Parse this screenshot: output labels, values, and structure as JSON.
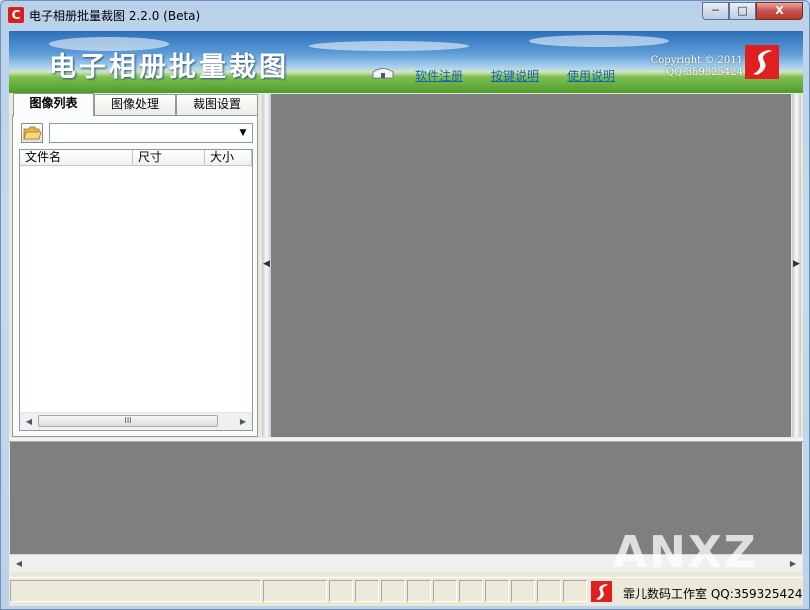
{
  "window": {
    "title": "电子相册批量裁图 2.2.0 (Beta)",
    "min_symbol": "─",
    "max_symbol": "□",
    "close_symbol": "X"
  },
  "banner": {
    "title": "电子相册批量裁图",
    "links": [
      "软件注册",
      "按键说明",
      "使用说明"
    ],
    "copyright_line1": "Copyright © 2011",
    "copyright_line2": "QQ:359325424"
  },
  "tabs": [
    {
      "label": "图像列表",
      "active": true
    },
    {
      "label": "图像处理",
      "active": false
    },
    {
      "label": "裁图设置",
      "active": false
    }
  ],
  "file_list": {
    "columns": [
      "文件名",
      "尺寸",
      "大小"
    ],
    "rows": [],
    "scroll_thumb_label": "III"
  },
  "splitter_arrows": {
    "left": "◀",
    "right": "▶"
  },
  "statusbar": {
    "text": "霏儿数码工作室 QQ:359325424"
  },
  "watermark": "ANXZ",
  "icons": {
    "app": "app-logo-icon",
    "folder": "open-folder-icon",
    "dropdown": "chevron-down-icon"
  },
  "colors": {
    "preview_bg": "#7f7f7f",
    "brand_red": "#e02020",
    "link_blue": "#1561b8"
  }
}
